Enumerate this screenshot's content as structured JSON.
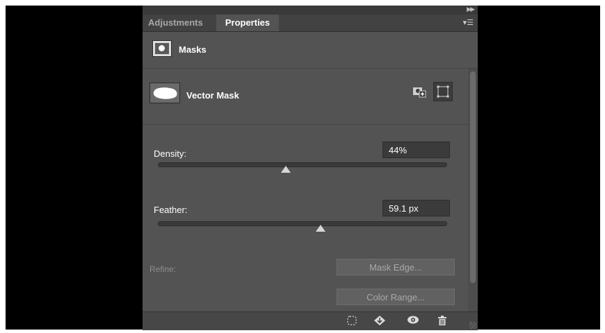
{
  "panel": {
    "tabs": [
      {
        "label": "Adjustments",
        "active": false
      },
      {
        "label": "Properties",
        "active": true
      }
    ],
    "collapse_icon": "double-chevron-right-icon",
    "menu_icon": "panel-menu-icon",
    "masks_title": "Masks",
    "vector_mask_label": "Vector Mask",
    "density": {
      "label": "Density:",
      "value": "44%",
      "level_percent": 44
    },
    "feather": {
      "label": "Feather:",
      "value": "59.1 px",
      "level_percent": 56
    },
    "refine_label": "Refine:",
    "mask_edge_button": "Mask Edge...",
    "color_range_button": "Color Range...",
    "bottom_icons": [
      "load-selection-icon",
      "apply-mask-icon",
      "eye-icon",
      "trash-icon"
    ]
  }
}
